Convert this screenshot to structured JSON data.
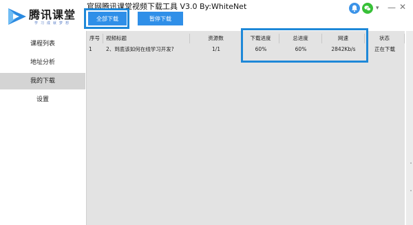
{
  "logo": {
    "text": "腾讯课堂",
    "slogan": "学习成就梦想",
    "colors": {
      "icon_blue": "#2b8ae0",
      "icon_light": "#6fbcf4"
    }
  },
  "window": {
    "title": "官网腾讯课堂视频下载工具 V3.0 By:WhiteNet",
    "controls": [
      "bell-icon",
      "wechat-icon",
      "menu-dropdown-icon",
      "minimize-icon",
      "close-icon"
    ]
  },
  "toolbar": {
    "download_all": "全部下载",
    "pause": "暂停下载"
  },
  "sidebar": {
    "items": [
      {
        "label": "课程列表",
        "active": false
      },
      {
        "label": "地址分析",
        "active": false
      },
      {
        "label": "我的下载",
        "active": true
      },
      {
        "label": "设置",
        "active": false
      }
    ]
  },
  "table": {
    "headers": {
      "seq": "序号",
      "title": "视频标题",
      "resources": "资源数",
      "download_progress": "下载进度",
      "total_progress": "总进度",
      "speed": "网速",
      "status": "状态"
    },
    "rows": [
      {
        "seq": "1",
        "title": "2、到底该如何在线学习开发?",
        "resources": "1/1",
        "download_progress": "60%",
        "total_progress": "60%",
        "speed": "2842Kb/s",
        "status": "正在下载"
      }
    ]
  },
  "colors": {
    "accent": "#2f8fe8",
    "highlight_border": "#1e88d8",
    "table_bg": "#e3e3e3",
    "sidebar_active": "#d4d4d4"
  }
}
